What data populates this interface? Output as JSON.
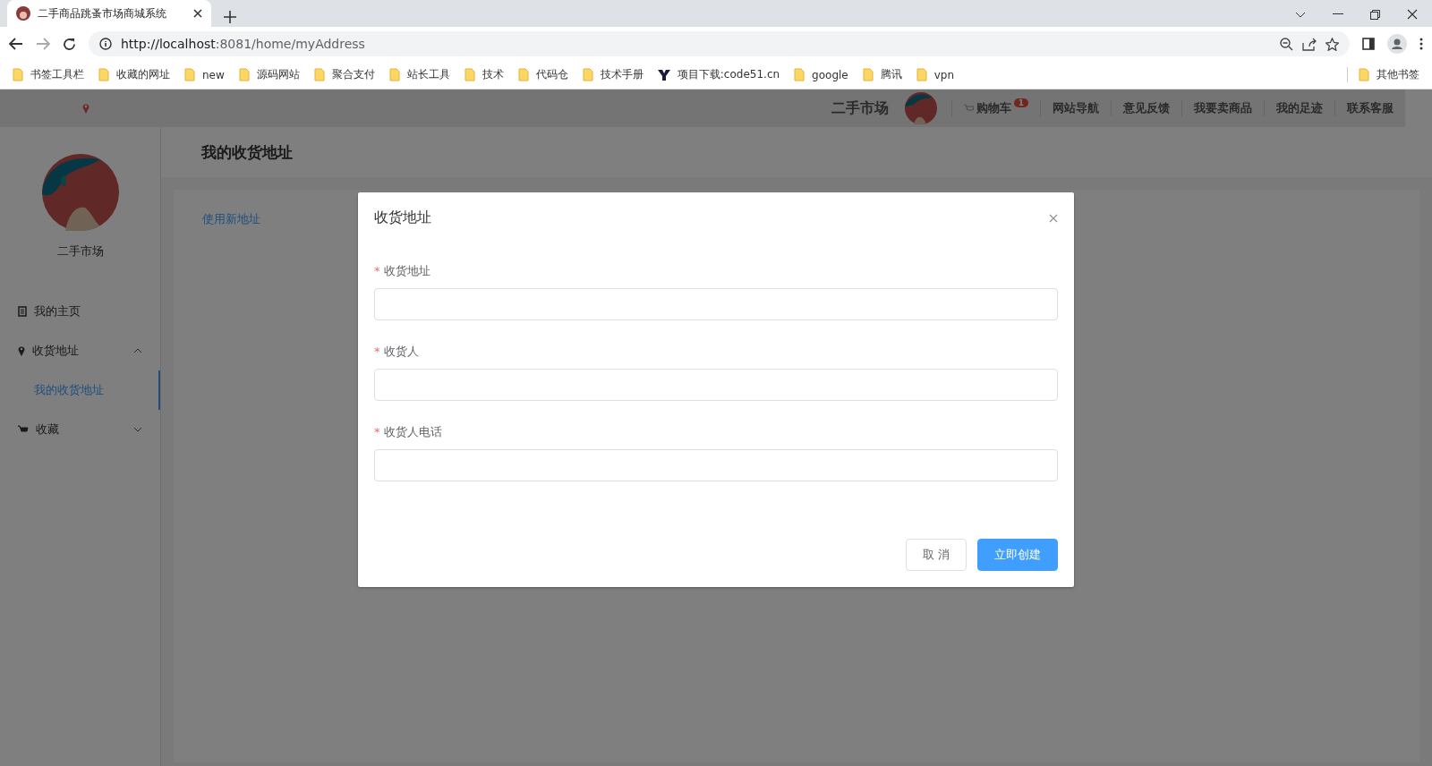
{
  "browser": {
    "tab_title": "二手商品跳蚤市场商城系统",
    "url_host": "http://localhost",
    "url_rest": ":8081/home/myAddress",
    "bookmarks": [
      {
        "label": "书签工具栏",
        "kind": "folder"
      },
      {
        "label": "收藏的网址",
        "kind": "folder"
      },
      {
        "label": "new",
        "kind": "folder"
      },
      {
        "label": "源码网站",
        "kind": "folder"
      },
      {
        "label": "聚合支付",
        "kind": "folder"
      },
      {
        "label": "站长工具",
        "kind": "folder"
      },
      {
        "label": "技术",
        "kind": "folder"
      },
      {
        "label": "代码仓",
        "kind": "folder"
      },
      {
        "label": "技术手册",
        "kind": "folder"
      },
      {
        "label": "项目下载:code51.cn",
        "kind": "site"
      },
      {
        "label": "google",
        "kind": "folder"
      },
      {
        "label": "腾讯",
        "kind": "folder"
      },
      {
        "label": "vpn",
        "kind": "folder"
      }
    ],
    "other_bookmarks": "其他书签"
  },
  "header": {
    "brand": "二手市场",
    "nav": [
      {
        "label": "购物车",
        "badge": "1",
        "kind": "cart"
      },
      {
        "label": "网站导航",
        "kind": "link"
      },
      {
        "label": "意见反馈",
        "kind": "link"
      },
      {
        "label": "我要卖商品",
        "kind": "link"
      },
      {
        "label": "我的足迹",
        "kind": "link"
      },
      {
        "label": "联系客服",
        "kind": "link"
      }
    ]
  },
  "sidebar": {
    "username": "二手市场",
    "menu": [
      {
        "label": "我的主页",
        "kind": "page",
        "selected": false
      },
      {
        "label": "收货地址",
        "kind": "pin",
        "expanded": true,
        "children": [
          {
            "label": "我的收货地址",
            "selected": true
          }
        ]
      },
      {
        "label": "收藏",
        "kind": "cart",
        "expanded": false
      }
    ]
  },
  "content": {
    "title": "我的收货地址",
    "link": "使用新地址"
  },
  "dialog": {
    "title": "收货地址",
    "required_mark": "*",
    "fields": [
      {
        "label": "收货地址",
        "required": true
      },
      {
        "label": "收货人",
        "required": true
      },
      {
        "label": "收货人电话",
        "required": true
      }
    ],
    "buttons": [
      {
        "label": "取 消",
        "kind": "default"
      },
      {
        "label": "立即创建",
        "kind": "primary"
      }
    ]
  }
}
